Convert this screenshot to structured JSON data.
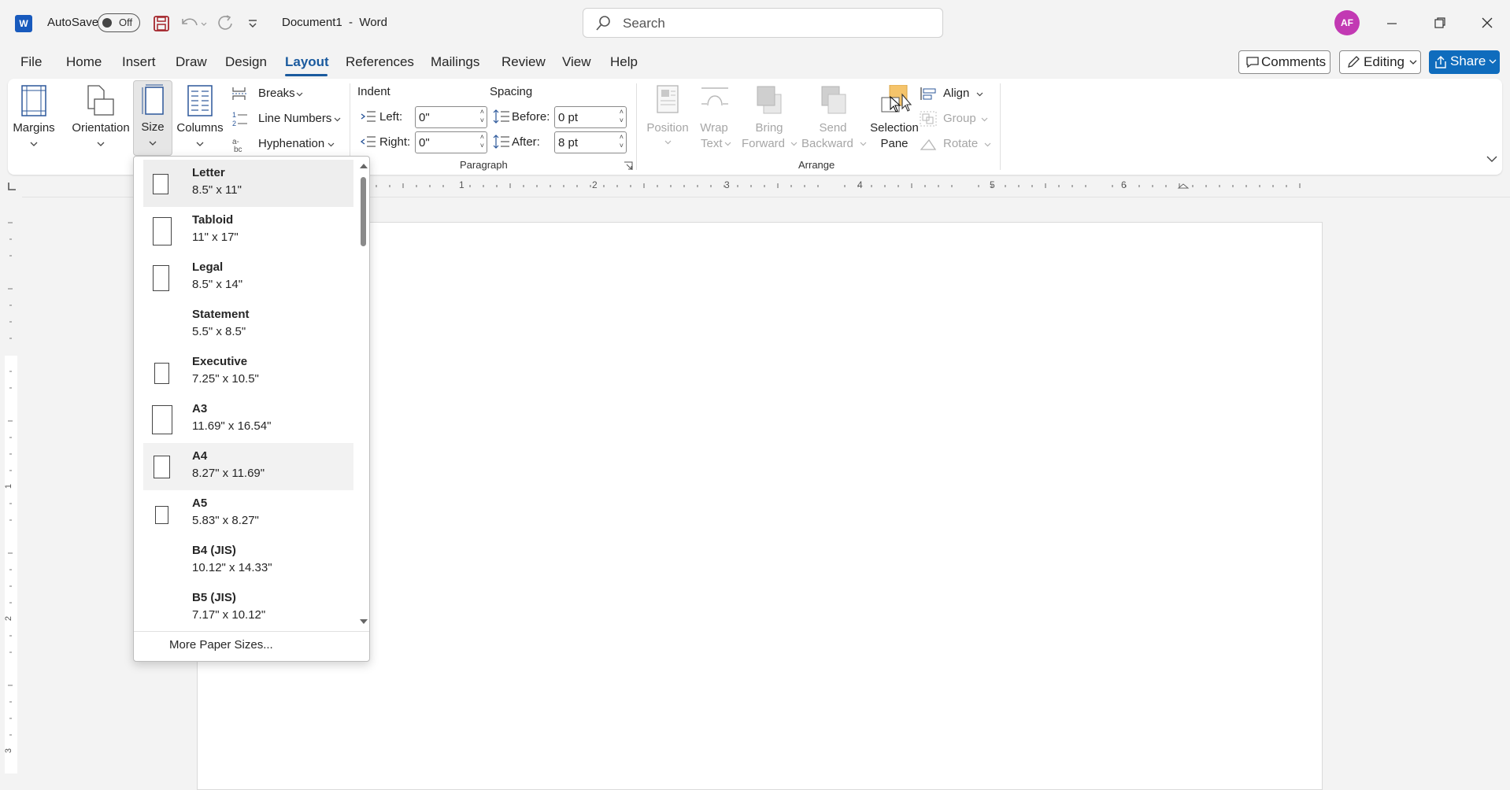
{
  "title_bar": {
    "app_icon": "word-logo",
    "autosave_label": "AutoSave",
    "autosave_state": "Off",
    "document_title": "Document1  -  Word",
    "search_placeholder": "Search",
    "avatar_initials": "AF"
  },
  "tabs": [
    "File",
    "Home",
    "Insert",
    "Draw",
    "Design",
    "Layout",
    "References",
    "Mailings",
    "Review",
    "View",
    "Help"
  ],
  "active_tab": "Layout",
  "right_actions": {
    "comments_label": "Comments",
    "editing_label": "Editing",
    "share_label": "Share"
  },
  "ribbon": {
    "page_setup": {
      "margins": "Margins",
      "orientation": "Orientation",
      "size": "Size",
      "columns": "Columns",
      "breaks": "Breaks",
      "line_numbers": "Line Numbers",
      "hyphenation": "Hyphenation"
    },
    "paragraph": {
      "group_label": "Paragraph",
      "indent_header": "Indent",
      "spacing_header": "Spacing",
      "left_label": "Left:",
      "left_value": "0\"",
      "right_label": "Right:",
      "right_value": "0\"",
      "before_label": "Before:",
      "before_value": "0 pt",
      "after_label": "After:",
      "after_value": "8 pt"
    },
    "arrange": {
      "group_label": "Arrange",
      "position": "Position",
      "wrap_text_1": "Wrap",
      "wrap_text_2": "Text",
      "bring_forward_1": "Bring",
      "bring_forward_2": "Forward",
      "send_backward_1": "Send",
      "send_backward_2": "Backward",
      "selection_pane_1": "Selection",
      "selection_pane_2": "Pane",
      "align": "Align",
      "group": "Group",
      "rotate": "Rotate"
    }
  },
  "ruler_numbers": [
    "1",
    "2",
    "3",
    "4",
    "5",
    "6"
  ],
  "vruler_numbers": [
    "1",
    "2",
    "3"
  ],
  "size_menu": {
    "items": [
      {
        "name": "Letter",
        "dims": "8.5\" x 11\""
      },
      {
        "name": "Tabloid",
        "dims": "11\" x 17\""
      },
      {
        "name": "Legal",
        "dims": "8.5\" x 14\""
      },
      {
        "name": "Statement",
        "dims": "5.5\" x 8.5\""
      },
      {
        "name": "Executive",
        "dims": "7.25\" x 10.5\""
      },
      {
        "name": "A3",
        "dims": "11.69\" x 16.54\""
      },
      {
        "name": "A4",
        "dims": "8.27\" x 11.69\""
      },
      {
        "name": "A5",
        "dims": "5.83\" x 8.27\""
      },
      {
        "name": "B4 (JIS)",
        "dims": "10.12\" x 14.33\""
      },
      {
        "name": "B5 (JIS)",
        "dims": "7.17\" x 10.12\""
      }
    ],
    "more_label": "More Paper Sizes..."
  },
  "colors": {
    "accent": "#1a5a9e",
    "share_button": "#0f6cbd",
    "avatar": "#c239b3",
    "selection_pane_icon": "#f5c46b"
  }
}
